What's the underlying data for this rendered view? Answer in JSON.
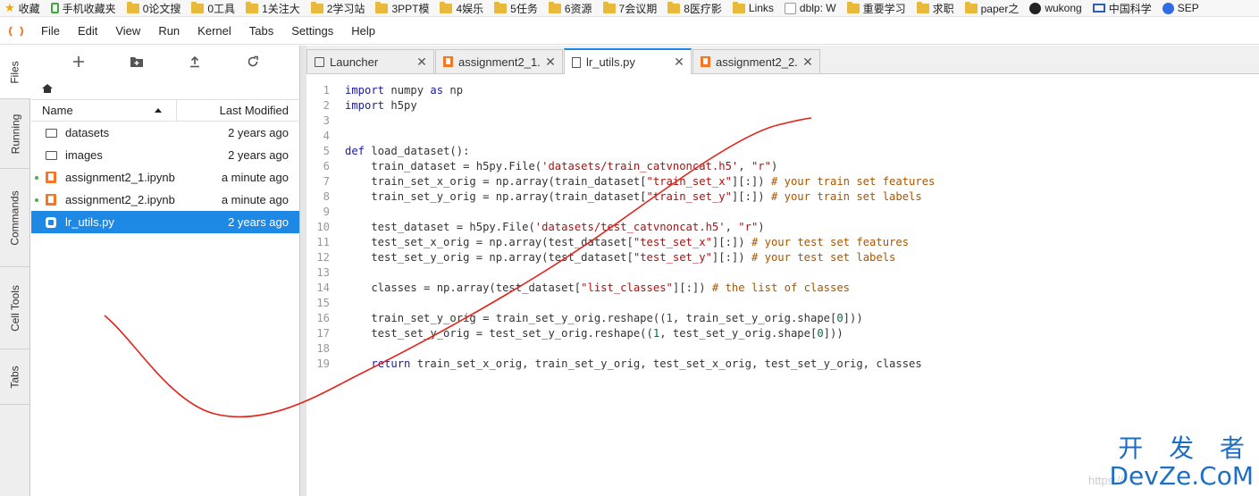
{
  "bookmarks": [
    {
      "label": "收藏",
      "icon": "star-icon"
    },
    {
      "label": "手机收藏夹",
      "icon": "phone-icon"
    },
    {
      "label": "0论文搜",
      "icon": "folder-icon"
    },
    {
      "label": "0工具",
      "icon": "folder-icon"
    },
    {
      "label": "1关注大",
      "icon": "folder-icon"
    },
    {
      "label": "2学习站",
      "icon": "folder-icon"
    },
    {
      "label": "3PPT模",
      "icon": "folder-icon"
    },
    {
      "label": "4娱乐",
      "icon": "folder-icon"
    },
    {
      "label": "5任务",
      "icon": "folder-icon"
    },
    {
      "label": "6资源",
      "icon": "folder-icon"
    },
    {
      "label": "7会议期",
      "icon": "folder-icon"
    },
    {
      "label": "8医疗影",
      "icon": "folder-icon"
    },
    {
      "label": "Links",
      "icon": "folder-icon"
    },
    {
      "label": "dblp: W",
      "icon": "page-icon"
    },
    {
      "label": "重要学习",
      "icon": "folder-icon"
    },
    {
      "label": "求职",
      "icon": "folder-icon"
    },
    {
      "label": "paper之",
      "icon": "folder-icon"
    },
    {
      "label": "wukong",
      "icon": "github-icon"
    },
    {
      "label": "中国科学",
      "icon": "mail-icon"
    },
    {
      "label": "SEP",
      "icon": "kubernetes-icon"
    }
  ],
  "menu": [
    "File",
    "Edit",
    "View",
    "Run",
    "Kernel",
    "Tabs",
    "Settings",
    "Help"
  ],
  "sidebar_tabs": [
    "Files",
    "Running",
    "Commands",
    "Cell Tools",
    "Tabs"
  ],
  "file_browser": {
    "columns": {
      "name": "Name",
      "modified": "Last Modified"
    },
    "files": [
      {
        "name": "datasets",
        "modified": "2 years ago",
        "type": "folder",
        "running": false
      },
      {
        "name": "images",
        "modified": "2 years ago",
        "type": "folder",
        "running": false
      },
      {
        "name": "assignment2_1.ipynb",
        "modified": "a minute ago",
        "type": "notebook",
        "running": true
      },
      {
        "name": "assignment2_2.ipynb",
        "modified": "a minute ago",
        "type": "notebook",
        "running": true
      },
      {
        "name": "lr_utils.py",
        "modified": "2 years ago",
        "type": "python",
        "running": false,
        "selected": true
      }
    ]
  },
  "tabs": [
    {
      "label": "Launcher",
      "icon": "launcher-icon",
      "active": false
    },
    {
      "label": "assignment2_1.",
      "icon": "notebook-icon",
      "active": false
    },
    {
      "label": "lr_utils.py",
      "icon": "file-icon",
      "active": true
    },
    {
      "label": "assignment2_2.",
      "icon": "notebook-icon",
      "active": false
    }
  ],
  "code_lines": [
    "import numpy as np",
    "import h5py",
    "",
    "",
    "def load_dataset():",
    "    train_dataset = h5py.File('datasets/train_catvnoncat.h5', \"r\")",
    "    train_set_x_orig = np.array(train_dataset[\"train_set_x\"][:]) # your train set features",
    "    train_set_y_orig = np.array(train_dataset[\"train_set_y\"][:]) # your train set labels",
    "",
    "    test_dataset = h5py.File('datasets/test_catvnoncat.h5', \"r\")",
    "    test_set_x_orig = np.array(test_dataset[\"test_set_x\"][:]) # your test set features",
    "    test_set_y_orig = np.array(test_dataset[\"test_set_y\"][:]) # your test set labels",
    "",
    "    classes = np.array(test_dataset[\"list_classes\"][:]) # the list of classes",
    "",
    "    train_set_y_orig = train_set_y_orig.reshape((1, train_set_y_orig.shape[0]))",
    "    test_set_y_orig = test_set_y_orig.reshape((1, test_set_y_orig.shape[0]))",
    "",
    "    return train_set_x_orig, train_set_y_orig, test_set_x_orig, test_set_y_orig, classes"
  ],
  "watermark": {
    "top": "开 发 者",
    "bottom": "DevZe.CoM",
    "faint": "https://"
  },
  "colors": {
    "accent": "#1e88e5",
    "notebook": "#f37726",
    "running": "#4caf50",
    "scribble": "#e2231a",
    "watermark": "#1e6fc4"
  }
}
